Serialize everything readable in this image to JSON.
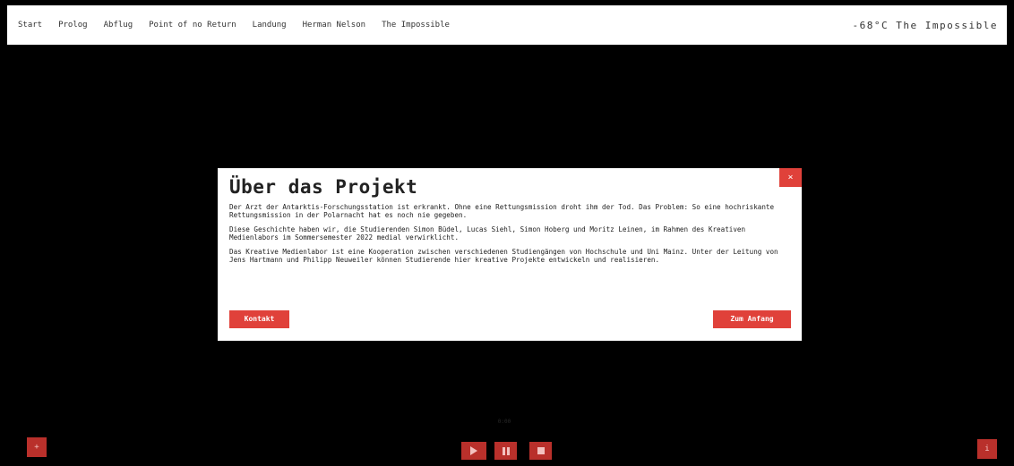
{
  "nav": {
    "links": [
      "Start",
      "Prolog",
      "Abflug",
      "Point of no Return",
      "Landung",
      "Herman Nelson",
      "The Impossible"
    ],
    "brand": "-68°C The Impossible"
  },
  "modal": {
    "title": "Über das Projekt",
    "close_label": "×",
    "paragraphs": [
      "Der Arzt der Antarktis-Forschungsstation ist erkrankt. Ohne eine Rettungsmission droht ihm der Tod. Das Problem: So eine hochriskante Rettungsmission in der Polarnacht hat es noch nie gegeben.",
      "Diese Geschichte haben wir, die Studierenden Simon Büdel, Lucas Siehl, Simon Hoberg und Moritz Leinen, im Rahmen des Kreativen Medienlabors im Sommersemester 2022 medial verwirklicht.",
      "Das Kreative Medienlabor ist eine Kooperation zwischen verschiedenen Studiengängen von Hochschule und Uni Mainz. Unter der Leitung von Jens Hartmann und Philipp Neuweiler können Studierende hier kreative Projekte entwickeln und realisieren."
    ],
    "kontakt_label": "Kontakt",
    "anfang_label": "Zum Anfang"
  },
  "controls": {
    "plus_label": "+",
    "info_label": "i",
    "timer": "0:00"
  },
  "colors": {
    "accent": "#e0413a",
    "accent_dark": "#b9302b",
    "background": "#000000"
  },
  "icons": {
    "play": "play-icon",
    "pause": "pause-icon",
    "stop": "stop-icon"
  }
}
